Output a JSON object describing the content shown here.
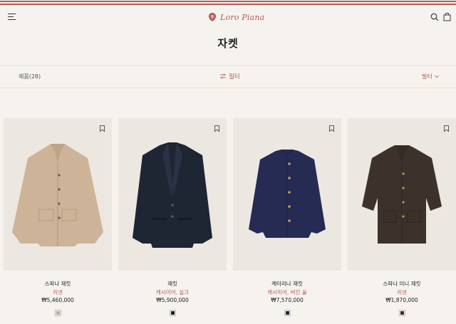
{
  "header": {
    "logo_text": "Loro Piana",
    "menu_icon": "menu-icon",
    "search_icon": "search-icon",
    "bag_icon": "shopping-bag-icon"
  },
  "page": {
    "title": "자켓"
  },
  "filter_bar": {
    "product_count": "제품(28)",
    "filter_label": "필터",
    "sort_label": "필터"
  },
  "colors": {
    "accent": "#b35a55",
    "background": "#f6f3ee",
    "card_background": "#ece7e1"
  },
  "products": [
    {
      "name": "스파나 재킷",
      "material": "리넨",
      "price": "₩5,460,000",
      "swatch_color": "#c9a98c",
      "jacket_color": "#cdb398"
    },
    {
      "name": "재킷",
      "material": "캐시미어, 실크",
      "price": "₩5,900,000",
      "swatch_color": "#1a1f2b",
      "jacket_color": "#1e2533"
    },
    {
      "name": "케터리나 재킷",
      "material": "캐시미어, 버진 울",
      "price": "₩7,570,000",
      "swatch_color": "#1f2440",
      "jacket_color": "#252b52"
    },
    {
      "name": "스파나 미니 재킷",
      "material": "리넨",
      "price": "₩1,870,000",
      "swatch_color": "#3a2e2a",
      "jacket_color": "#3d312c"
    }
  ]
}
